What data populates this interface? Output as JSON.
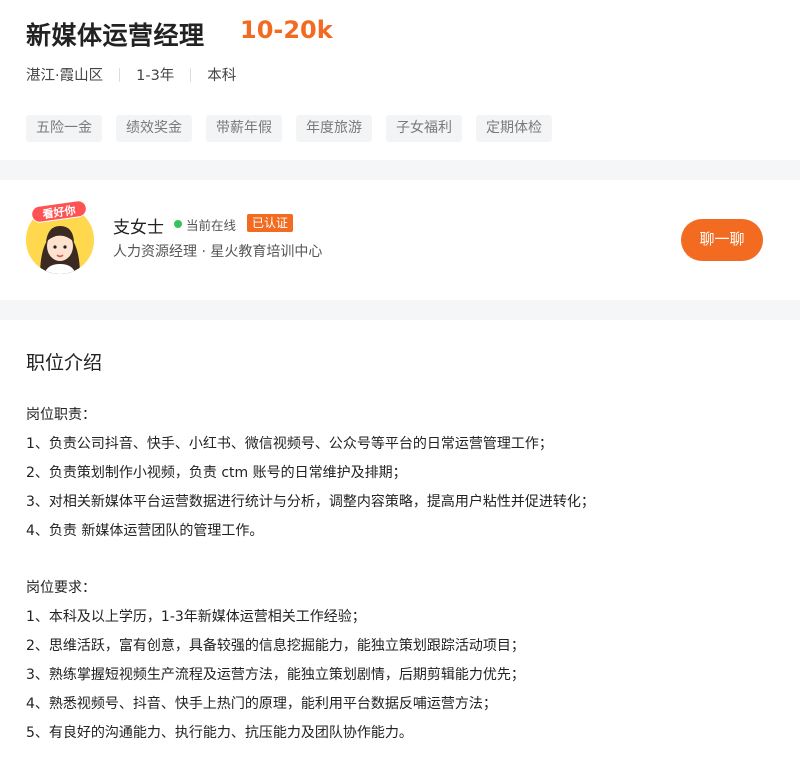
{
  "job": {
    "title": "新媒体运营经理",
    "salary": "10-20k",
    "location": "湛江·霞山区",
    "experience": "1-3年",
    "education": "本科",
    "benefits": [
      "五险一金",
      "绩效奖金",
      "带薪年假",
      "年度旅游",
      "子女福利",
      "定期体检"
    ]
  },
  "recruiter": {
    "avatar_badge": "看好你",
    "name": "支女士",
    "status": "当前在线",
    "verified": "已认证",
    "position_company": "人力资源经理 · 星火教育培训中心",
    "chat_button": "聊一聊",
    "colors": {
      "accent": "#f26b21",
      "online": "#38c25f"
    }
  },
  "description": {
    "section_title": "职位介绍",
    "duties_heading": "岗位职责：",
    "duties": [
      "1、负责公司抖音、快手、小红书、微信视频号、公众号等平台的日常运营管理工作；",
      "2、负责策划制作小视频，负责 ctm 账号的日常维护及排期；",
      "3、对相关新媒体平台运营数据进行统计与分析，调整内容策略，提高用户粘性并促进转化；",
      "4、负责 新媒体运营团队的管理工作。"
    ],
    "requirements_heading": "岗位要求：",
    "requirements": [
      "1、本科及以上学历，1-3年新媒体运营相关工作经验；",
      "2、思维活跃，富有创意，具备较强的信息挖掘能力，能独立策划跟踪活动项目；",
      "3、熟练掌握短视频生产流程及运营方法，能独立策划剧情，后期剪辑能力优先；",
      "4、熟悉视频号、抖音、快手上热门的原理，能利用平台数据反哺运营方法；",
      "5、有良好的沟通能力、执行能力、抗压能力及团队协作能力。"
    ]
  }
}
